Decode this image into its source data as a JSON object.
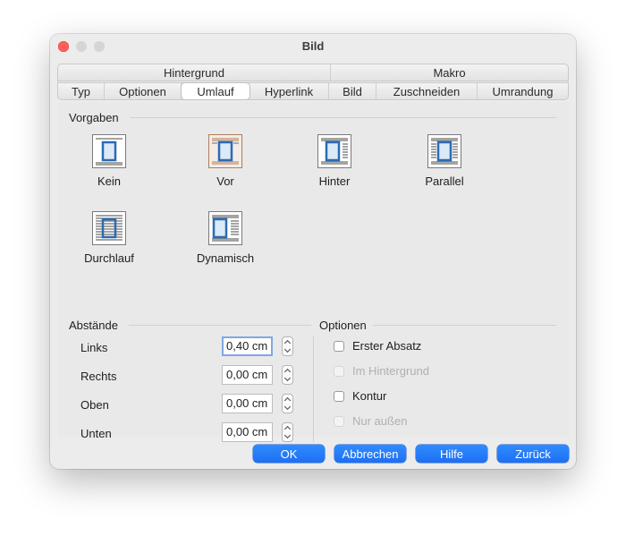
{
  "window": {
    "title": "Bild"
  },
  "tabs_row1": [
    "Hintergrund",
    "Makro"
  ],
  "tabs_row2": [
    "Typ",
    "Optionen",
    "Umlauf",
    "Hyperlink",
    "Bild",
    "Zuschneiden",
    "Umrandung"
  ],
  "active_tab": "Umlauf",
  "vorgaben": {
    "title": "Vorgaben",
    "options": [
      {
        "label": "Kein",
        "icon": "wrap-none-icon",
        "selected": false
      },
      {
        "label": "Vor",
        "icon": "wrap-before-icon",
        "selected": true
      },
      {
        "label": "Hinter",
        "icon": "wrap-after-icon",
        "selected": false
      },
      {
        "label": "Parallel",
        "icon": "wrap-parallel-icon",
        "selected": false
      },
      {
        "label": "Durchlauf",
        "icon": "wrap-through-icon",
        "selected": false
      },
      {
        "label": "Dynamisch",
        "icon": "wrap-optimal-icon",
        "selected": false
      }
    ]
  },
  "abstaende": {
    "title": "Abstände",
    "fields": [
      {
        "label": "Links",
        "value": "0,40 cm",
        "focused": true
      },
      {
        "label": "Rechts",
        "value": "0,00 cm",
        "focused": false
      },
      {
        "label": "Oben",
        "value": "0,00 cm",
        "focused": false
      },
      {
        "label": "Unten",
        "value": "0,00 cm",
        "focused": false
      }
    ]
  },
  "optionen": {
    "title": "Optionen",
    "checks": [
      {
        "label": "Erster Absatz",
        "checked": false,
        "enabled": true
      },
      {
        "label": "Im Hintergrund",
        "checked": false,
        "enabled": false
      },
      {
        "label": "Kontur",
        "checked": false,
        "enabled": true
      },
      {
        "label": "Nur außen",
        "checked": false,
        "enabled": false
      }
    ]
  },
  "buttons": {
    "ok": "OK",
    "cancel": "Abbrechen",
    "help": "Hilfe",
    "reset": "Zurück"
  },
  "colors": {
    "accent": "#1f6ff2",
    "close": "#ff5f57"
  }
}
